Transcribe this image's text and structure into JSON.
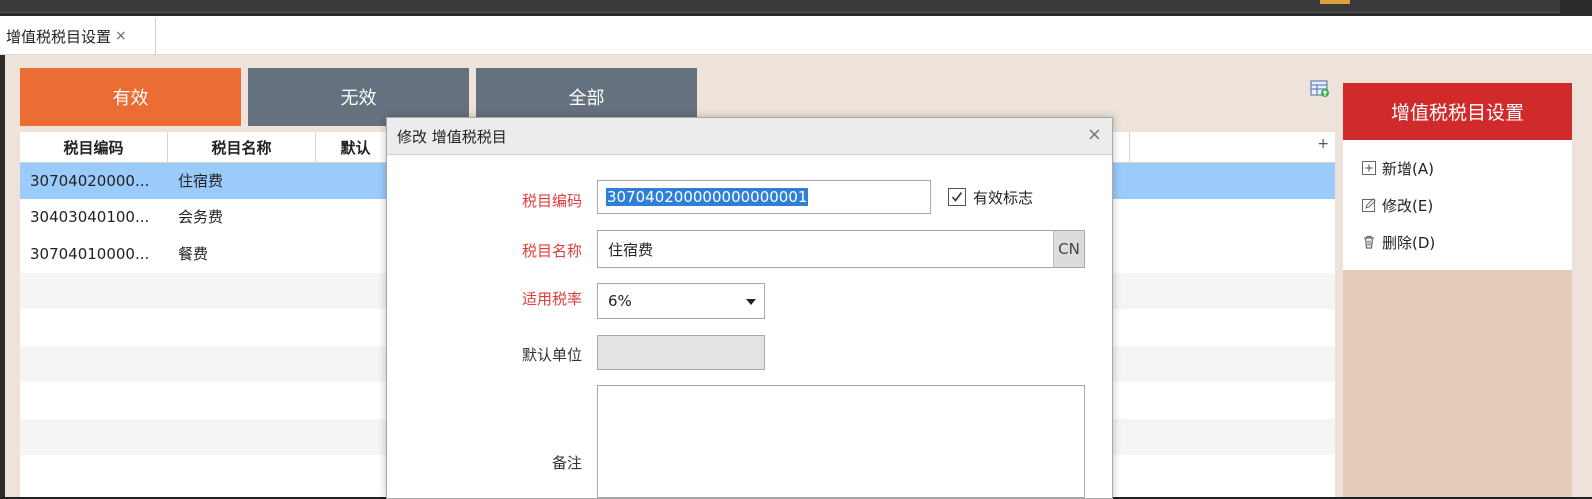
{
  "tab": {
    "label": "增值税税目设置",
    "close": "×"
  },
  "status_buttons": {
    "valid": "有效",
    "invalid": "无效",
    "all": "全部"
  },
  "grid": {
    "headers": [
      "税目编码",
      "税目名称",
      "默认"
    ],
    "plus": "+",
    "rows": [
      {
        "code": "30704020000...",
        "name": "住宿费"
      },
      {
        "code": "30403040100...",
        "name": "会务费"
      },
      {
        "code": "30704010000...",
        "name": "餐费"
      }
    ]
  },
  "right_panel": {
    "title": "增值税税目设置",
    "add": "新增(A)",
    "edit": "修改(E)",
    "delete": "删除(D)"
  },
  "dialog": {
    "title": "修改 增值税税目",
    "close": "×",
    "labels": {
      "code": "税目编码",
      "name": "税目名称",
      "rate": "适用税率",
      "unit": "默认单位",
      "note": "备注"
    },
    "code_value": "307040200000000000001",
    "name_value": "住宿费",
    "cn_button": "CN",
    "rate_value": "6%",
    "valid_flag_label": "有效标志",
    "valid_flag_checked": true
  },
  "colors": {
    "accent_orange": "#ec6d34",
    "button_gray": "#66717f",
    "panel_red": "#d12a2a",
    "selected_row": "#9acbfa",
    "required_label": "#e23b3b"
  }
}
